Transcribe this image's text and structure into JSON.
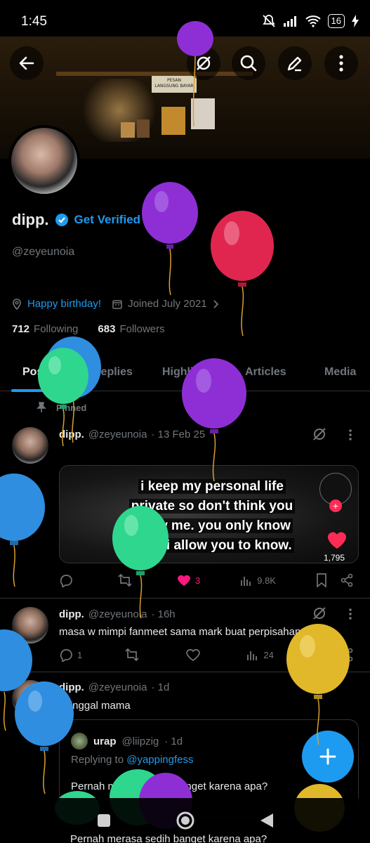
{
  "status_bar": {
    "time": "1:45",
    "battery": "16"
  },
  "profile": {
    "name": "dipp.",
    "verify_link": "Get Verified",
    "handle": "@zeyeunoia",
    "bio_location": "Happy birthday!",
    "joined": "Joined July 2021",
    "following_count": "712",
    "following_label": "Following",
    "followers_count": "683",
    "followers_label": "Followers"
  },
  "banner": {
    "sign_line1": "PESAN",
    "sign_line2": "LANGSUNG BAYAR"
  },
  "tabs": [
    "Posts",
    "Replies",
    "Highlights",
    "Articles",
    "Media"
  ],
  "pinned_label": "Pinned",
  "posts": [
    {
      "name": "dipp.",
      "handle": "@zeyeunoia",
      "time": "· 13 Feb 25",
      "media_caption": [
        "i keep my personal life",
        "private so don't think you",
        "know me. you only know",
        "what i allow you to know."
      ],
      "media_likes": "1,795",
      "replies": "",
      "reposts": "",
      "likes": "3",
      "views": "9.8K"
    },
    {
      "name": "dipp.",
      "handle": "@zeyeunoia",
      "time": "· 16h",
      "text": "masa w mimpi fanmeet sama mark buat perpisahan dia😭",
      "replies": "1",
      "reposts": "",
      "likes": "",
      "views": "24"
    },
    {
      "name": "dipp.",
      "handle": "@zeyeunoia",
      "time": "· 1d",
      "text": "ditinggal mama",
      "quote": {
        "name": "urap",
        "handle": "@liipzig",
        "time": "· 1d",
        "replying_prefix": "Replying to ",
        "replying_to": "@yappingfess",
        "text": "Pernah merasa sedih banget karena apa?"
      }
    }
  ],
  "peek_text": "Pernah merasa sedih banget karena apa?",
  "colors": {
    "accent": "#1d9bf0",
    "like": "#f91880",
    "balloon_purple": "#8e2fd6",
    "balloon_red": "#e0264f",
    "balloon_blue": "#2f8ee0",
    "balloon_green": "#2fd68e",
    "balloon_yellow": "#e0b82a"
  }
}
